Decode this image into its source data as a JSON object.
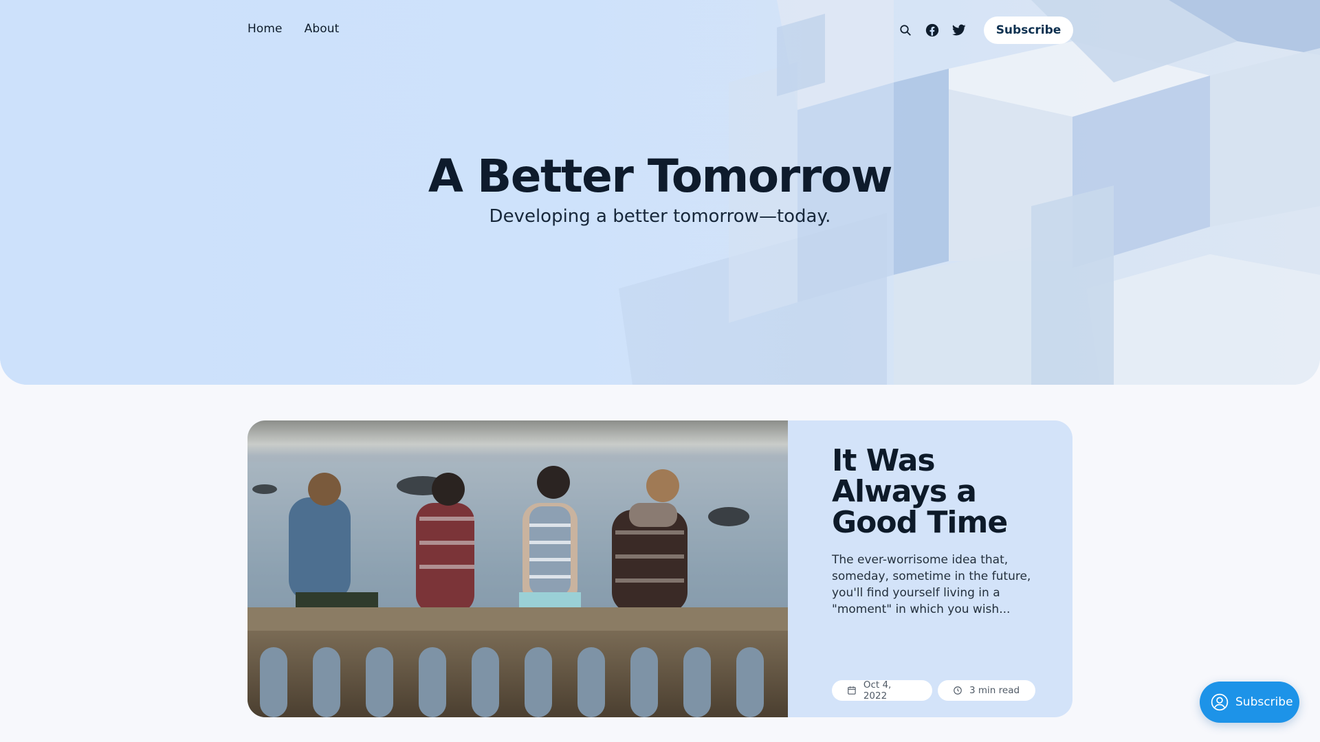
{
  "nav": {
    "links": [
      {
        "label": "Home"
      },
      {
        "label": "About"
      }
    ],
    "icons": [
      "search-icon",
      "facebook-icon",
      "twitter-icon"
    ],
    "subscribe_label": "Subscribe"
  },
  "hero": {
    "title": "A Better Tomorrow",
    "subtitle": "Developing a better tomorrow—today."
  },
  "featured_post": {
    "title": "It Was Always a Good Time",
    "excerpt": "The ever-worrisome idea that, someday, sometime in the future, you'll find yourself living in a \"moment\" in which you wish...",
    "date": "Oct 4, 2022",
    "read_time": "3 min read"
  },
  "portal": {
    "label": "Subscribe"
  },
  "colors": {
    "hero_background": "#cbe0fb",
    "card_background": "#d3e3f9",
    "portal_button": "#1d93e8",
    "heading": "#0e1b2c"
  }
}
